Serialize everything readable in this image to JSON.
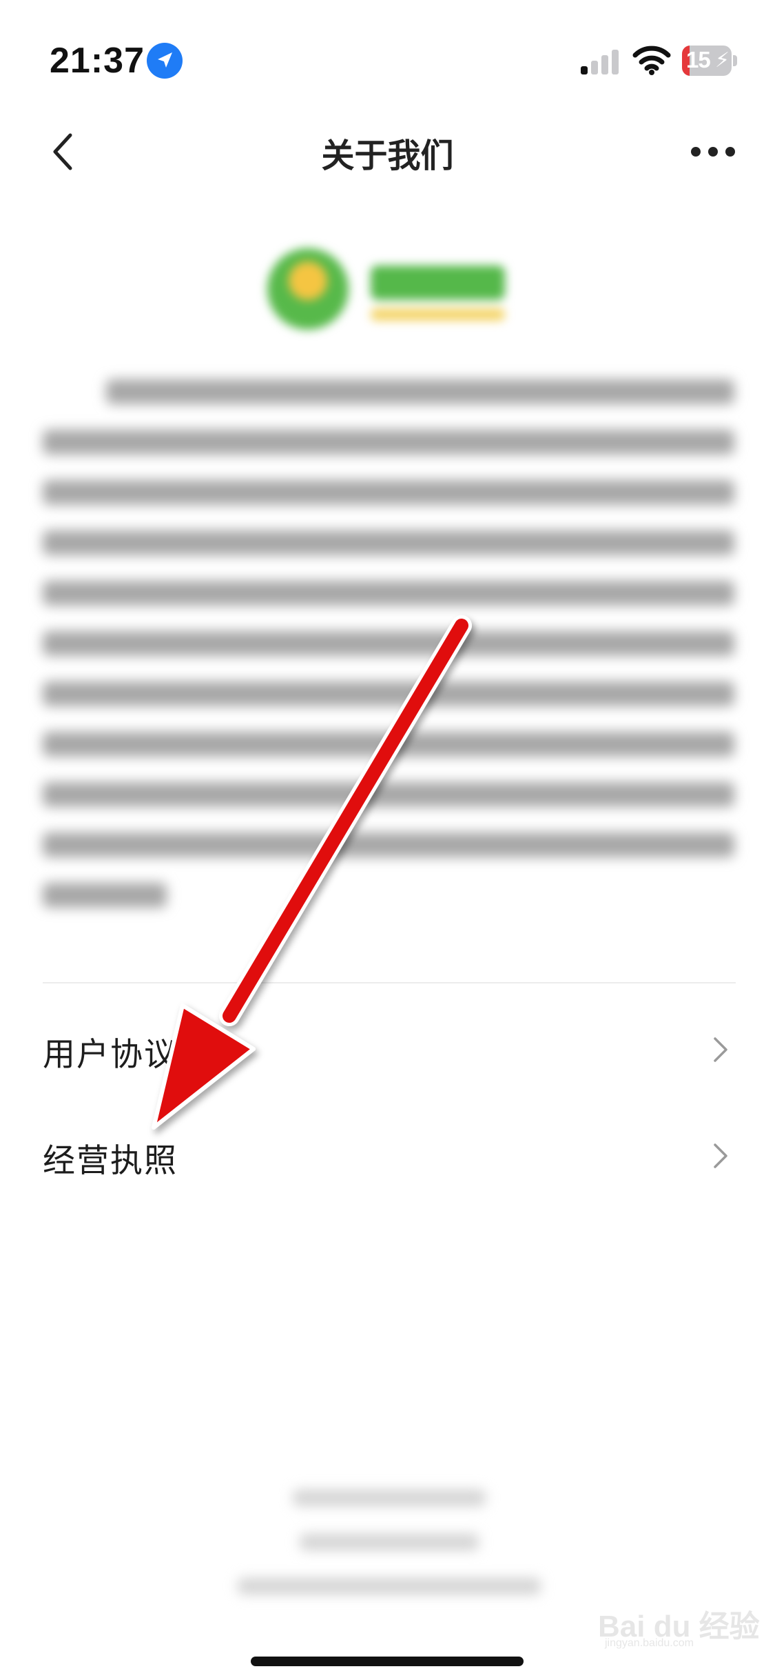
{
  "status_bar": {
    "time": "21:37",
    "battery_percent": "15",
    "battery_level": 0.15,
    "location_icon": "location-arrow-icon",
    "signal_icon": "cellular-signal-icon",
    "wifi_icon": "wifi-icon",
    "battery_icon": "battery-charging-icon"
  },
  "nav": {
    "title": "关于我们",
    "back_icon": "chevron-left-icon",
    "more_icon": "more-horizontal-icon"
  },
  "menu": {
    "items": [
      {
        "label": "用户协议",
        "icon": "chevron-right-icon"
      },
      {
        "label": "经营执照",
        "icon": "chevron-right-icon"
      }
    ]
  },
  "watermark": {
    "text": "Bai du 经验",
    "sub": "jingyan.baidu.com"
  },
  "colors": {
    "accent_arrow": "#e0070b",
    "location_badge": "#1f7cf6",
    "battery_low": "#e5383b",
    "logo_green": "#55b84a",
    "logo_yellow": "#f4d56a"
  }
}
